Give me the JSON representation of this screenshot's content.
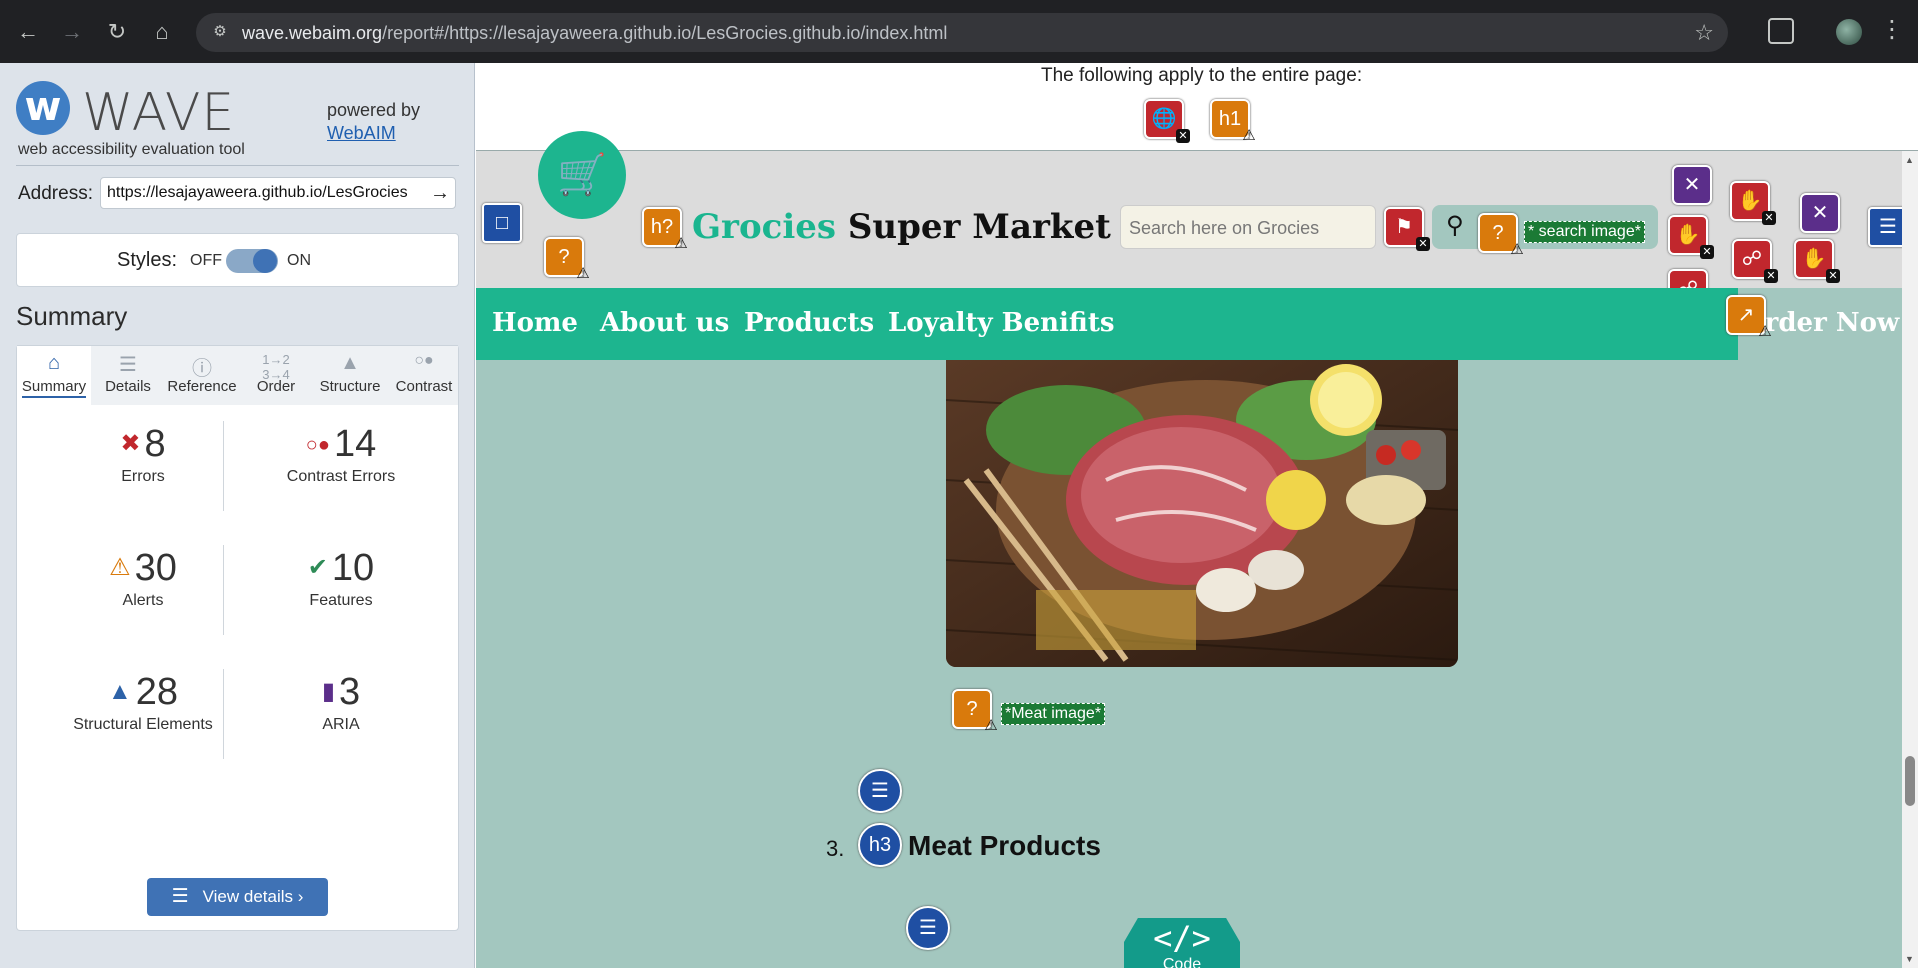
{
  "browser": {
    "url_host": "wave.webaim.org",
    "url_path": "/report#/https://lesajayaweera.github.io/LesGrocies.github.io/index.html"
  },
  "wave": {
    "title": "WAVE",
    "tagline": "web accessibility evaluation tool",
    "powered_by": "powered by",
    "webaim_link": "WebAIM",
    "address_label": "Address:",
    "address_value": "https://lesajayaweera.github.io/LesGrocies",
    "styles_label": "Styles:",
    "styles_off": "OFF",
    "styles_on": "ON",
    "styles_enabled": true,
    "summary_heading": "Summary",
    "tabs": [
      {
        "label": "Summary",
        "icon": "home-icon",
        "active": true
      },
      {
        "label": "Details",
        "icon": "list-icon",
        "active": false
      },
      {
        "label": "Reference",
        "icon": "info-icon",
        "active": false
      },
      {
        "label": "Order",
        "icon": "order-icon",
        "active": false
      },
      {
        "label": "Structure",
        "icon": "structure-icon",
        "active": false
      },
      {
        "label": "Contrast",
        "icon": "contrast-icon",
        "active": false
      }
    ],
    "stats": {
      "errors": {
        "count": "8",
        "label": "Errors",
        "color": "#c1272d"
      },
      "contrast_errors": {
        "count": "14",
        "label": "Contrast Errors",
        "color": "#c1272d"
      },
      "alerts": {
        "count": "30",
        "label": "Alerts",
        "color": "#d97a0c"
      },
      "features": {
        "count": "10",
        "label": "Features",
        "color": "#2e8b57"
      },
      "structural": {
        "count": "28",
        "label": "Structural Elements",
        "color": "#2d62a8"
      },
      "aria": {
        "count": "3",
        "label": "ARIA",
        "color": "#5b2e8a"
      }
    },
    "view_details": "View details ›"
  },
  "page": {
    "entire_page_msg": "The following apply to the entire page:",
    "site_brand_green": "Grocies",
    "site_brand_black": "Super Market",
    "search_placeholder": "Search here on Grocies",
    "search_image_label": "* search image*",
    "nav": [
      "Home",
      "About us",
      "Products",
      "Loyalty Benifits"
    ],
    "order_now": "Order Now",
    "meat_image_label": "*Meat image*",
    "heading_number": "3.",
    "heading_text": "Meat Products",
    "code_symbol": "</>",
    "code_label": "Code",
    "badge_h1": "h1",
    "badge_h_unknown": "h?",
    "badge_h3": "h3"
  }
}
